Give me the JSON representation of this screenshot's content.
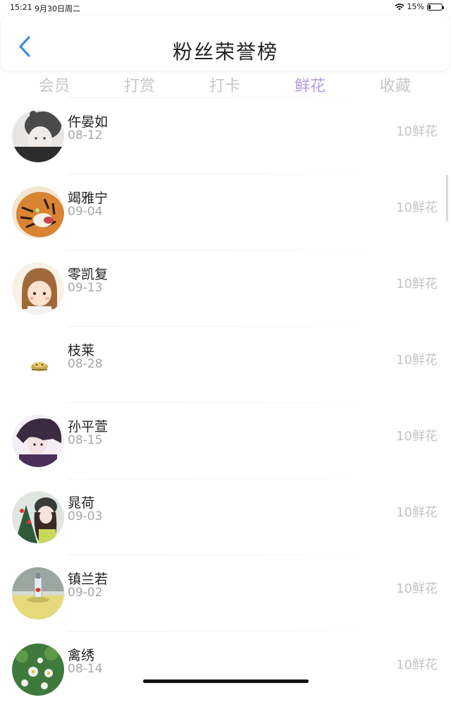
{
  "status_bar": {
    "time": "15:21",
    "date": "9月30日周二",
    "battery": "15%",
    "battery_level": 0.15
  },
  "header": {
    "title": "粉丝荣誉榜",
    "back_icon": "chevron-left-icon",
    "accent_color": "#3a8fe8"
  },
  "tabs": [
    {
      "label": "会员",
      "active": false
    },
    {
      "label": "打赏",
      "active": false
    },
    {
      "label": "打卡",
      "active": false
    },
    {
      "label": "鲜花",
      "active": true
    },
    {
      "label": "收藏",
      "active": false
    }
  ],
  "active_tab_color": "#b79be2",
  "fans": [
    {
      "name": "仵晏如",
      "date": "08-12",
      "amount": "10鲜花",
      "avatar": "girl-knit-hat-avatar"
    },
    {
      "name": "竭雅宁",
      "date": "09-04",
      "amount": "10鲜花",
      "avatar": "tiger-avatar"
    },
    {
      "name": "零凯复",
      "date": "09-13",
      "amount": "10鲜花",
      "avatar": "cartoon-girl-avatar"
    },
    {
      "name": "枝莱",
      "date": "08-28",
      "amount": "10鲜花",
      "avatar": "small-object-avatar"
    },
    {
      "name": "孙平萱",
      "date": "08-15",
      "amount": "10鲜花",
      "avatar": "purple-portrait-avatar"
    },
    {
      "name": "晁荷",
      "date": "09-03",
      "amount": "10鲜花",
      "avatar": "girl-christmas-avatar"
    },
    {
      "name": "镇兰若",
      "date": "09-02",
      "amount": "10鲜花",
      "avatar": "bottle-avatar"
    },
    {
      "name": "禽绣",
      "date": "08-14",
      "amount": "10鲜花",
      "avatar": "flowers-avatar"
    }
  ]
}
